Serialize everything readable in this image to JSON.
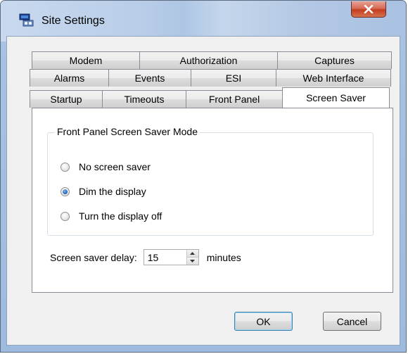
{
  "window": {
    "title": "Site Settings",
    "close_glyph": "x"
  },
  "tabs": {
    "row1": [
      "Modem",
      "Authorization",
      "Captures"
    ],
    "row2": [
      "Alarms",
      "Events",
      "ESI",
      "Web Interface"
    ],
    "row3": [
      "Startup",
      "Timeouts",
      "Front Panel",
      "Screen Saver"
    ],
    "active": "Screen Saver"
  },
  "screen_saver": {
    "group_title": "Front Panel Screen Saver Mode",
    "options": [
      {
        "label": "No screen saver",
        "selected": false
      },
      {
        "label": "Dim the display",
        "selected": true
      },
      {
        "label": "Turn the display off",
        "selected": false
      }
    ],
    "delay_label": "Screen saver delay:",
    "delay_value": "15",
    "delay_unit": "minutes"
  },
  "buttons": {
    "ok": "OK",
    "cancel": "Cancel"
  },
  "colors": {
    "accent": "#3c7fb1",
    "close": "#c43d21",
    "radio_selected": "#1c5fb7"
  }
}
